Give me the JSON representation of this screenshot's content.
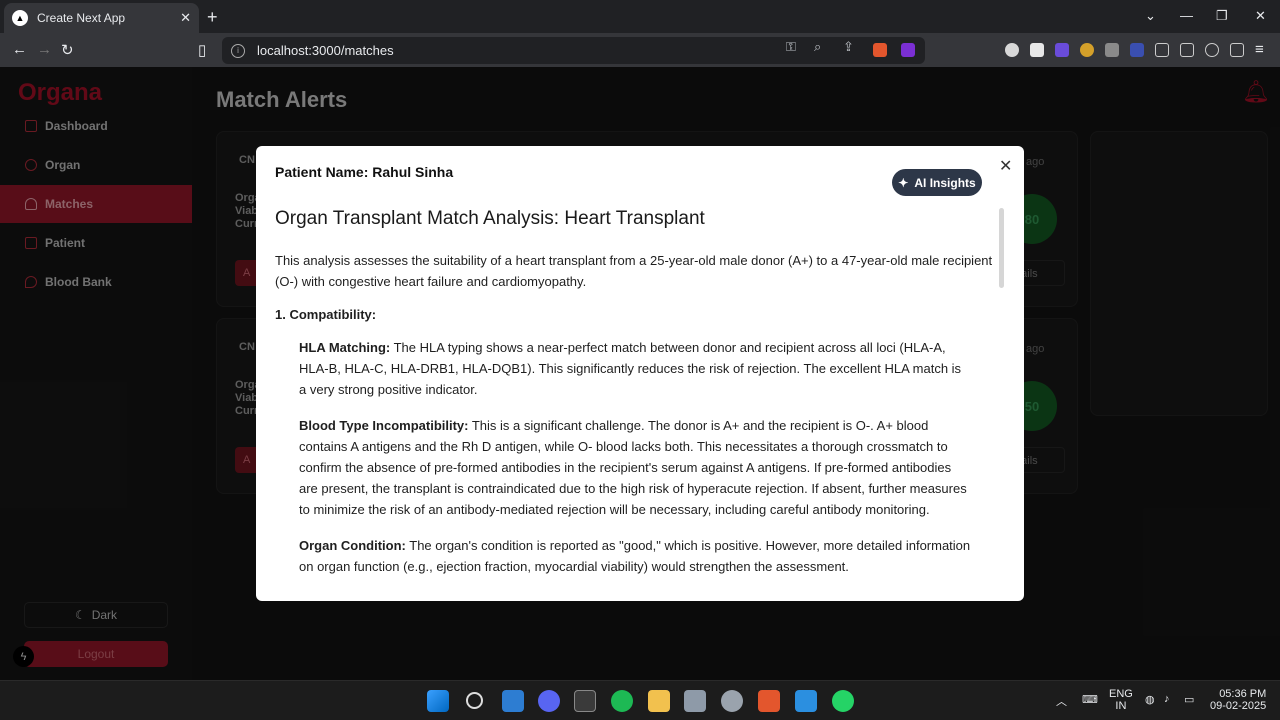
{
  "browser": {
    "tab_title": "Create Next App",
    "url": "localhost:3000/matches",
    "new_tab": "+"
  },
  "sidebar": {
    "brand": "Organa",
    "items": [
      {
        "label": "Dashboard"
      },
      {
        "label": "Organ"
      },
      {
        "label": "Matches"
      },
      {
        "label": "Patient"
      },
      {
        "label": "Blood Bank"
      }
    ],
    "dark_label": "Dark",
    "logout_label": "Logout"
  },
  "main": {
    "title": "Match Alerts",
    "cards": [
      {
        "code": "CN",
        "lines": [
          "Orga",
          "Viab",
          "Curr"
        ],
        "action": "A",
        "ago": "ys ago",
        "score": "80",
        "details": "etails"
      },
      {
        "code": "CN",
        "lines": [
          "Orga",
          "Viab",
          "Curr"
        ],
        "action": "A",
        "ago": "ys ago",
        "score": "50",
        "details": "etails"
      }
    ]
  },
  "modal": {
    "patient": "Patient Name: Rahul Sinha",
    "ai_button": "AI Insights",
    "heading": "Organ Transplant Match Analysis: Heart Transplant",
    "intro": "This analysis assesses the suitability of a heart transplant from a 25-year-old male donor (A+) to a 47-year-old male recipient (O-) with congestive heart failure and cardiomyopathy.",
    "section1": "1. Compatibility:",
    "items": [
      {
        "label": "HLA Matching:",
        "text": " The HLA typing shows a near-perfect match between donor and recipient across all loci (HLA-A, HLA-B, HLA-C, HLA-DRB1, HLA-DQB1). This significantly reduces the risk of rejection. The excellent HLA match is a very strong positive indicator."
      },
      {
        "label": "Blood Type Incompatibility:",
        "text": " This is a significant challenge. The donor is A+ and the recipient is O-. A+ blood contains A antigens and the Rh D antigen, while O- blood lacks both. This necessitates a thorough crossmatch to confirm the absence of pre-formed antibodies in the recipient's serum against A antigens. If pre-formed antibodies are present, the transplant is contraindicated due to the high risk of hyperacute rejection. If absent, further measures to minimize the risk of an antibody-mediated rejection will be necessary, including careful antibody monitoring."
      },
      {
        "label": "Organ Condition:",
        "text": " The organ's condition is reported as \"good,\" which is positive. However, more detailed information on organ function (e.g., ejection fraction, myocardial viability) would strengthen the assessment."
      }
    ]
  },
  "taskbar": {
    "lang_top": "ENG",
    "lang_bottom": "IN",
    "time": "05:36 PM",
    "date": "09-02-2025"
  },
  "colors": {
    "brand": "#b3122a",
    "active_nav": "#a1182c",
    "ai_button": "#2d3748",
    "score": "#146126"
  }
}
